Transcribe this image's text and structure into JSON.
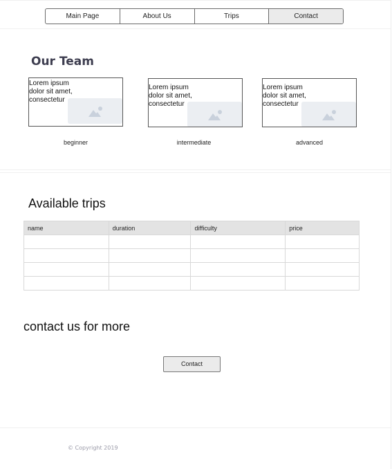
{
  "nav": {
    "items": [
      "Main Page",
      "About Us",
      "Trips",
      "Contact"
    ],
    "active": "Contact"
  },
  "team": {
    "title": "Our Team",
    "cards": [
      {
        "text": "Lorem ipsum dolor sit amet, consectetur",
        "label": "beginner",
        "icon": "image-placeholder-icon"
      },
      {
        "text": "Lorem ipsum dolor sit amet, consectetur",
        "label": "intermediate",
        "icon": "image-placeholder-icon"
      },
      {
        "text": "Lorem ipsum dolor sit amet, consectetur",
        "label": "advanced",
        "icon": "image-placeholder-icon"
      }
    ]
  },
  "trips": {
    "title": "Available trips",
    "columns": [
      "name",
      "duration",
      "difficulty",
      "price"
    ],
    "rows": [
      [
        "",
        "",
        "",
        ""
      ],
      [
        "",
        "",
        "",
        ""
      ],
      [
        "",
        "",
        "",
        ""
      ],
      [
        "",
        "",
        "",
        ""
      ]
    ]
  },
  "contact": {
    "title": "contact us for more",
    "button": "Contact"
  },
  "footer": {
    "copyright": "© Copyright 2019"
  }
}
